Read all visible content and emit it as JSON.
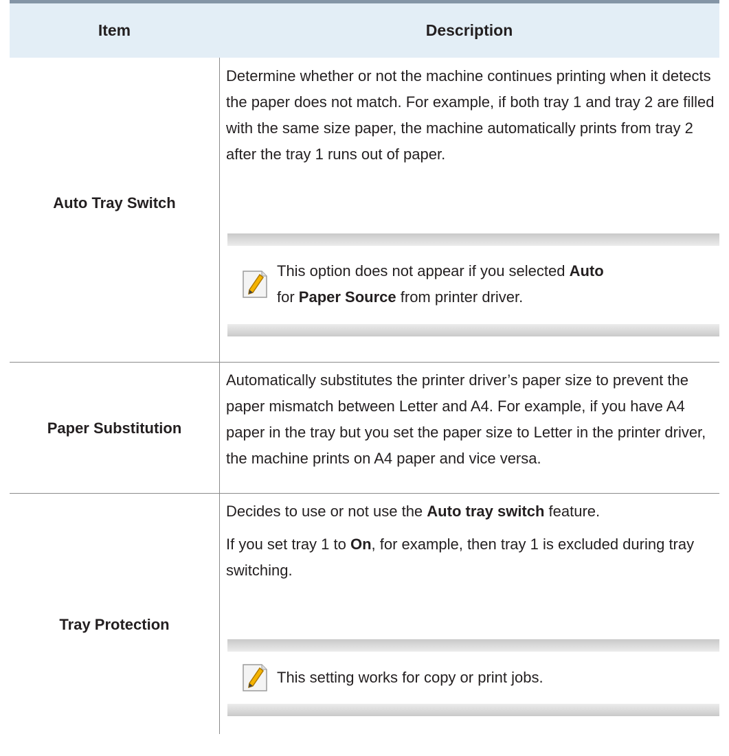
{
  "table": {
    "header": {
      "item": "Item",
      "description": "Description"
    },
    "rows": [
      {
        "item": "Auto Tray Switch",
        "description": "Determine whether or not the machine continues printing when it detects the paper does not match. For example, if both tray 1 and tray 2 are filled with the same size paper, the machine automatically prints from tray 2 after the tray 1 runs out of paper.",
        "note": {
          "icon": "note-pencil-icon",
          "t1": "This option does not appear if you selected ",
          "b1": "Auto",
          "t2": " for ",
          "b2": "Paper Source",
          "t3": " from printer driver."
        }
      },
      {
        "item": "Paper Substitution",
        "description": "Automatically substitutes the printer driver’s paper size to prevent the paper mismatch between Letter and A4. For example, if you have A4 paper in the tray but you set the paper size to Letter in the printer driver, the machine prints on A4 paper and vice versa."
      },
      {
        "item": "Tray Protection",
        "p1": {
          "t1": "Decides to use or not use the ",
          "b1": "Auto tray switch",
          "t2": " feature."
        },
        "p2": {
          "t1": "If you set tray 1 to ",
          "b1": "On",
          "t2": ", for example, then tray 1 is excluded during tray switching."
        },
        "note": {
          "icon": "note-pencil-icon",
          "text": "This setting works for copy or print jobs."
        }
      }
    ]
  }
}
